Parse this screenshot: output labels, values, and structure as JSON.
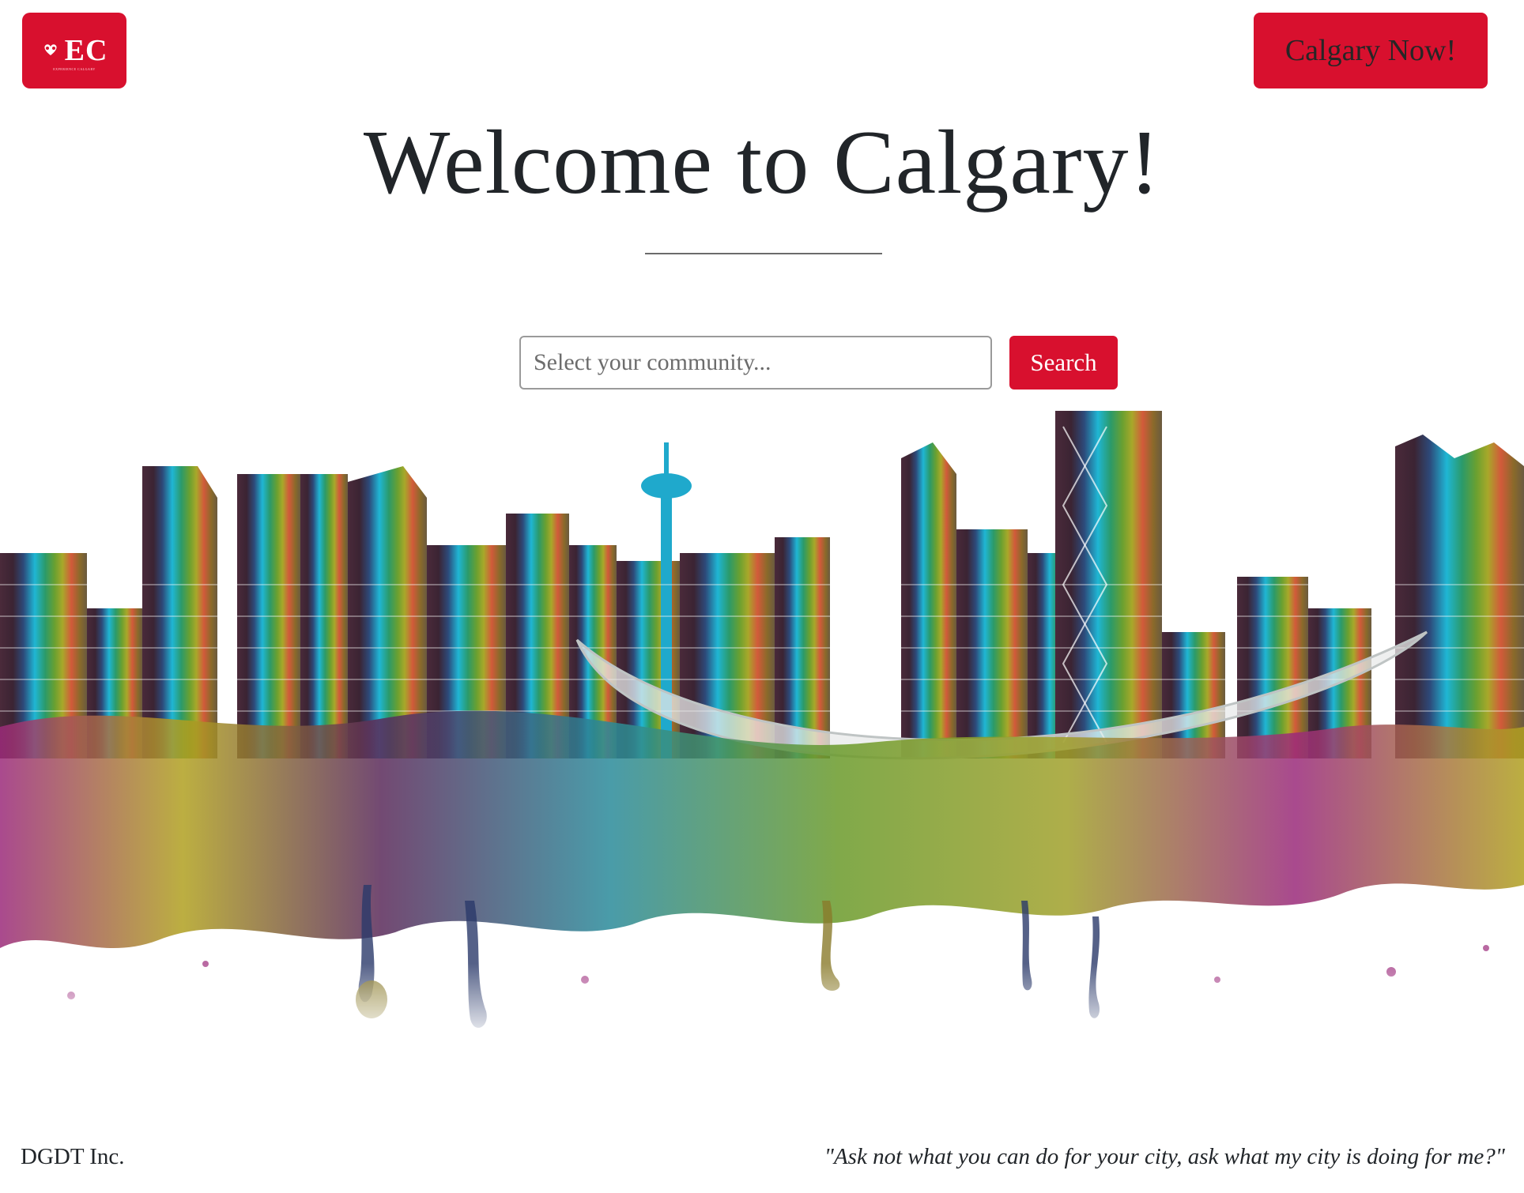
{
  "header": {
    "logo": {
      "text": "EC",
      "subtext": "EXPERIENCE CALGARY",
      "icon": "hands-heart-icon"
    },
    "cta_label": "Calgary Now!"
  },
  "hero": {
    "title": "Welcome to Calgary!"
  },
  "search": {
    "placeholder": "Select your community...",
    "button_label": "Search"
  },
  "footer": {
    "company": "DGDT Inc.",
    "quote": "\"Ask not what you can do for your city, ask what my city is doing for me?\""
  },
  "colors": {
    "brand_red": "#d8102e",
    "text": "#212529"
  }
}
